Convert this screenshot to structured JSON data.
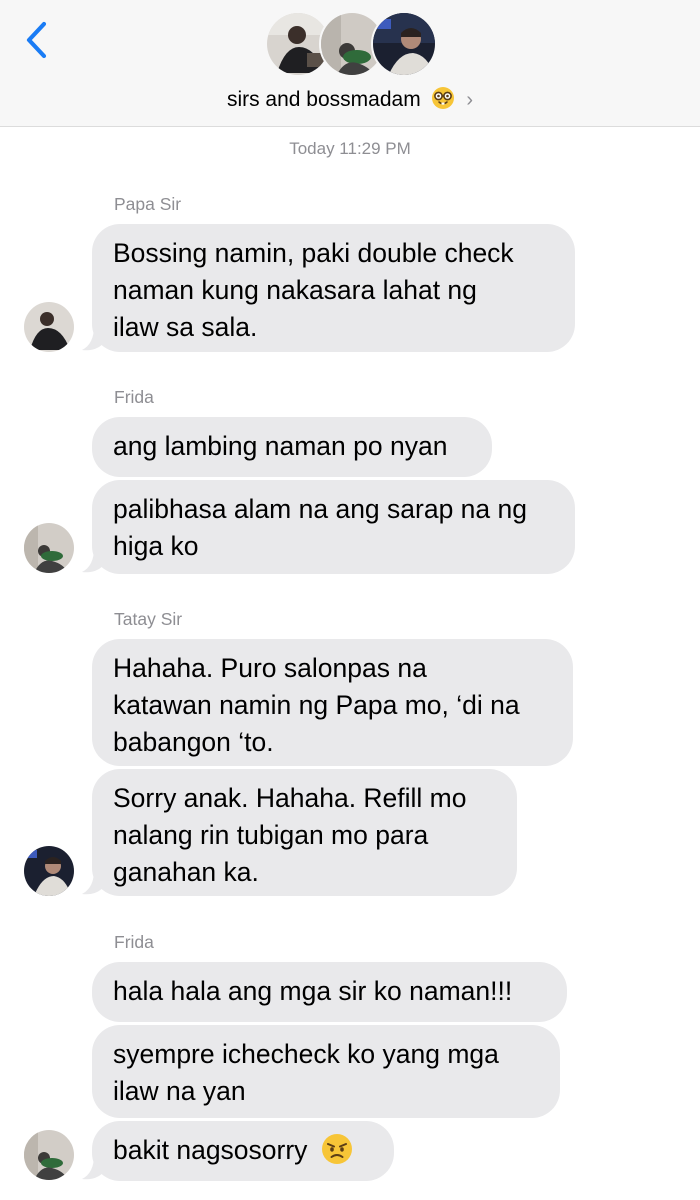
{
  "header": {
    "back_icon": "chevron-left-icon",
    "group_name": "sirs and bossmadam",
    "group_emoji": "nerd-face-emoji",
    "disclosure_icon": "chevron-right-icon",
    "accent_color": "#1a7cf5"
  },
  "thread": {
    "timestamp": "Today 11:29 PM",
    "groups": [
      {
        "sender": "Papa Sir",
        "messages": [
          {
            "lines": [
              "Bossing namin, paki double check",
              "naman kung nakasara lahat ng",
              "ilaw sa sala."
            ]
          }
        ]
      },
      {
        "sender": "Frida",
        "messages": [
          {
            "lines": [
              "ang lambing naman po nyan"
            ]
          },
          {
            "lines": [
              "palibhasa alam na ang sarap na ng",
              "higa ko"
            ]
          }
        ]
      },
      {
        "sender": "Tatay Sir",
        "messages": [
          {
            "lines": [
              "Hahaha. Puro salonpas na",
              "katawan namin ng Papa mo, ‘di na",
              "babangon ‘to."
            ]
          },
          {
            "lines": [
              "Sorry anak. Hahaha. Refill mo",
              "nalang rin tubigan mo para",
              "ganahan ka."
            ]
          }
        ]
      },
      {
        "sender": "Frida",
        "messages": [
          {
            "lines": [
              "hala hala ang mga sir ko naman!!!"
            ]
          },
          {
            "lines": [
              "syempre ichecheck ko yang mga",
              "ilaw na yan"
            ]
          },
          {
            "lines": [
              "bakit nagsosorry"
            ],
            "emoji": "angry-face-emoji"
          }
        ]
      }
    ]
  },
  "colors": {
    "bubble_bg": "#e9e9eb",
    "meta_text": "#8e8e93",
    "header_bg": "#f7f7f7"
  }
}
